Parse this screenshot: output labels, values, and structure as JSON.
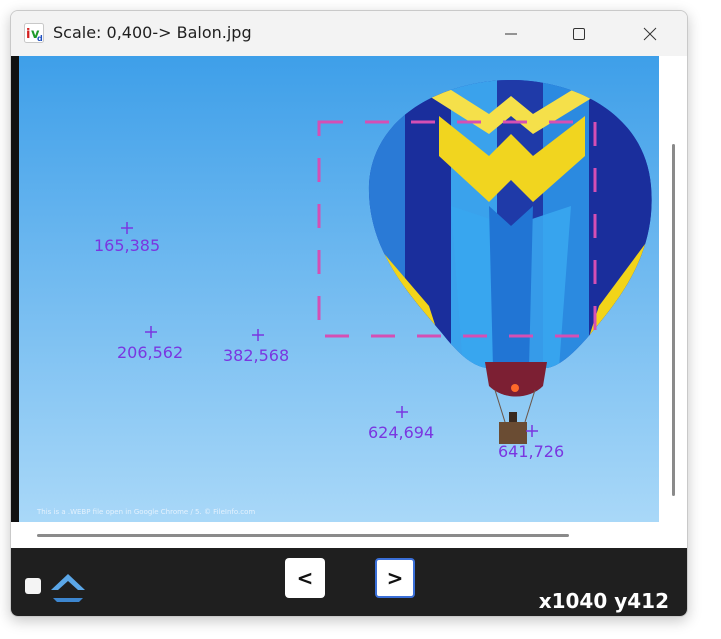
{
  "window": {
    "title": "Scale: 0,400-> Balon.jpg",
    "app_icon": "irfanview-icon",
    "controls": [
      "minimize-icon",
      "maximize-icon",
      "close-icon"
    ]
  },
  "image": {
    "watermark": "This is a .WEBP file open in Google Chrome / 5. © FileInfo.com",
    "markers": [
      {
        "label": "165,385"
      },
      {
        "label": "206,562"
      },
      {
        "label": "382,568"
      },
      {
        "label": "624,694"
      },
      {
        "label": "641,726"
      }
    ],
    "colors": {
      "marker": "#7a36e0",
      "selection": "#d54fb4",
      "sky_top": "#3e9fe9",
      "sky_bottom": "#a9d8f8"
    }
  },
  "bottombar": {
    "prev_label": "<",
    "next_label": ">",
    "cursor_readout": "x1040 y412",
    "home_icon": "home-icon"
  }
}
